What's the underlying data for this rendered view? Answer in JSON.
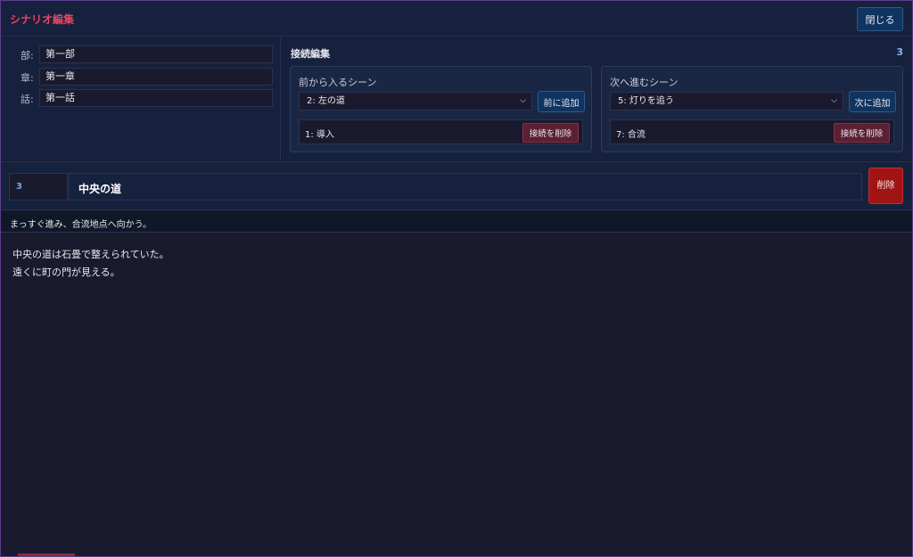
{
  "header": {
    "title": "シナリオ編集",
    "close_label": "閉じる"
  },
  "meta": {
    "fields": [
      {
        "label": "部:",
        "value": "第一部"
      },
      {
        "label": "章:",
        "value": "第一章"
      },
      {
        "label": "話:",
        "value": "第一話"
      }
    ]
  },
  "connections": {
    "title": "接続編集",
    "count": "3",
    "incoming": {
      "title": "前から入るシーン",
      "selected": "2: 左の道",
      "add_label": "前に追加",
      "item": "1: 導入",
      "remove_label": "接続を削除"
    },
    "outgoing": {
      "title": "次へ進むシーン",
      "selected": "5: 灯りを追う",
      "add_label": "次に追加",
      "item": "7: 合流",
      "remove_label": "接続を削除"
    }
  },
  "scene": {
    "id": "3",
    "name": "中央の道",
    "delete_label": "削除",
    "summary": "まっすぐ進み、合流地点へ向かう。",
    "body_lines": [
      "中央の道は石畳で整えられていた。",
      "遠くに町の門が見える。"
    ]
  },
  "colors": {
    "accent": "#e94560",
    "background": "#1a1a2e",
    "panel": "#16213e",
    "button": "#0f3460",
    "danger": "#a01414"
  }
}
